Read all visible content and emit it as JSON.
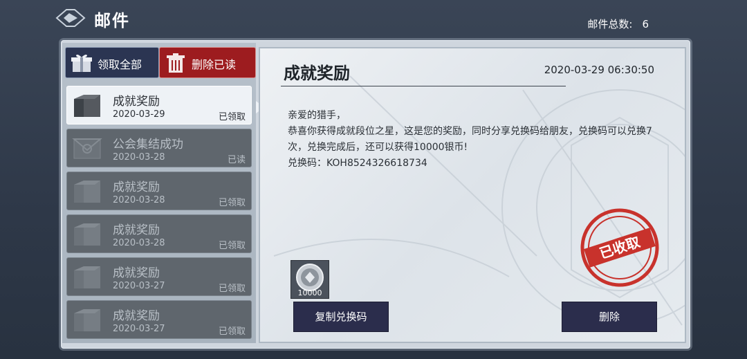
{
  "header": {
    "title": "邮件",
    "count_label": "邮件总数:",
    "count_value": "6"
  },
  "actions": {
    "claim_all": "领取全部",
    "delete_read": "删除已读"
  },
  "mails": [
    {
      "title": "成就奖励",
      "date": "2020-03-29",
      "status": "已领取",
      "selected": true
    },
    {
      "title": "公会集结成功",
      "date": "2020-03-28",
      "status": "已读"
    },
    {
      "title": "成就奖励",
      "date": "2020-03-28",
      "status": "已领取"
    },
    {
      "title": "成就奖励",
      "date": "2020-03-28",
      "status": "已领取"
    },
    {
      "title": "成就奖励",
      "date": "2020-03-27",
      "status": "已领取"
    },
    {
      "title": "成就奖励",
      "date": "2020-03-27",
      "status": "已领取"
    }
  ],
  "detail": {
    "title": "成就奖励",
    "timestamp": "2020-03-29 06:30:50",
    "greeting": "亲爱的猎手，",
    "body": "恭喜你获得成就段位之星，这是您的奖励，同时分享兑换码给朋友，兑换码可以兑换7次，兑换完成后，还可以获得10000银币!",
    "code_line": "兑换码：KOH8524326618734",
    "item_qty": "10000",
    "stamp_text": "已收取",
    "copy_button": "复制兑换码",
    "delete_button": "删除"
  },
  "colors": {
    "delete_read_bg": "#9d1c1f",
    "claim_bg": "#2b3552",
    "stamp": "#c8322c"
  }
}
